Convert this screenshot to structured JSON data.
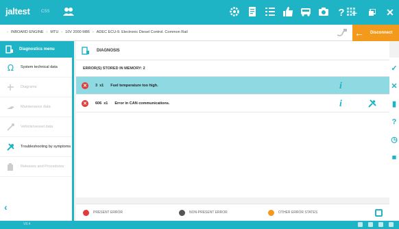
{
  "app": {
    "logo": "jaltest",
    "logo_sub": "CSS"
  },
  "breadcrumb": [
    "INBOARD ENGINE",
    "MTU",
    "10V 2000 M86",
    "ADEC ECU-9. Electronic Diesel Control. Common Rail"
  ],
  "toolbar": {
    "disconnect_label": "Disconnect"
  },
  "sidebar": {
    "header": "Diagnostics menu",
    "items": [
      {
        "label": "System technical data",
        "icon": "omega-icon",
        "enabled": true
      },
      {
        "label": "Diagrams",
        "icon": "diagram-icon",
        "enabled": false
      },
      {
        "label": "Maintenance data",
        "icon": "maintenance-icon",
        "enabled": false
      },
      {
        "label": "Vehicle/vessel data",
        "icon": "vehicle-icon",
        "enabled": false
      },
      {
        "label": "Troubleshooting by symptoms",
        "icon": "troubleshooting-icon",
        "enabled": true
      },
      {
        "label": "Releases and Procedures",
        "icon": "procedures-icon",
        "enabled": false
      }
    ]
  },
  "main": {
    "title": "DIAGNOSIS",
    "subtitle": "ERROR(S) STORED IN MEMORY: 2",
    "errors": [
      {
        "code": "3",
        "occurrences": "x1",
        "description": "Fuel temperature too high.",
        "selected": true,
        "has_repair": false
      },
      {
        "code": "606",
        "occurrences": "x1",
        "description": "Error in CAN communications.",
        "selected": false,
        "has_repair": true
      }
    ]
  },
  "legend": {
    "present": "PRESENT ERROR",
    "non_present": "NON-PRESENT ERROR",
    "other": "OTHER ERROR STATES",
    "colors": {
      "present": "#e03c3c",
      "non_present": "#555555",
      "other": "#f39a1c"
    }
  },
  "status": {
    "text": "V8.4"
  },
  "colors": {
    "accent": "#1eb3c5",
    "orange": "#f39a1c",
    "selected_row": "#8fd9e2"
  }
}
